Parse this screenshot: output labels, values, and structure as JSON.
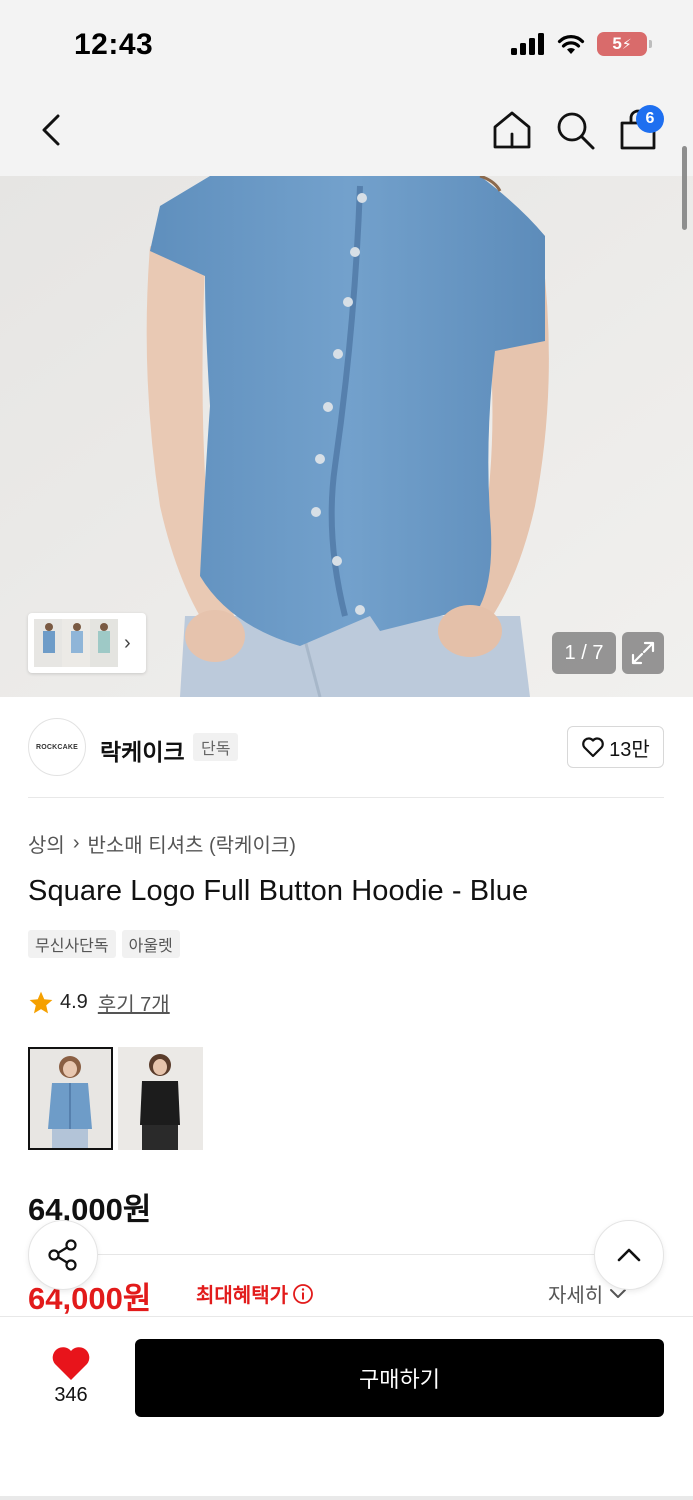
{
  "status_bar": {
    "time": "12:43",
    "battery": "5",
    "icons": [
      "signal-icon",
      "wifi-icon",
      "battery-icon"
    ]
  },
  "nav": {
    "icons": [
      "back-icon",
      "home-icon",
      "search-icon",
      "cart-icon"
    ],
    "cart_badge": "6"
  },
  "hero": {
    "page_indicator": "1 / 7",
    "colors": {
      "shirt": "#6e9cc8",
      "background": "#ecebe9",
      "jeans": "#b9c9d8"
    }
  },
  "brand": {
    "logo_text": "ROCKCAKE",
    "name": "락케이크",
    "tag": "단독",
    "likes": "13만"
  },
  "product": {
    "breadcrumb": [
      "상의",
      "반소매 티셔츠 (락케이크)"
    ],
    "title": "Square Logo Full Button Hoodie - Blue",
    "tags": [
      "무신사단독",
      "아울렛"
    ],
    "rating": "4.9",
    "review_link": "후기 7개",
    "color_options": [
      {
        "name": "blue",
        "color": "#6e9cc8"
      },
      {
        "name": "black",
        "color": "#1c1c1c"
      }
    ],
    "price": "64,000원",
    "benefit_price": "64,000원",
    "benefit_label": "최대혜택가",
    "detail_link": "자세히"
  },
  "bottom_bar": {
    "wish_count": "346",
    "buy_label": "구매하기"
  },
  "colors": {
    "accent_red": "#e21b1b",
    "badge_blue": "#1e6ff0",
    "buy_button": "#000000"
  }
}
